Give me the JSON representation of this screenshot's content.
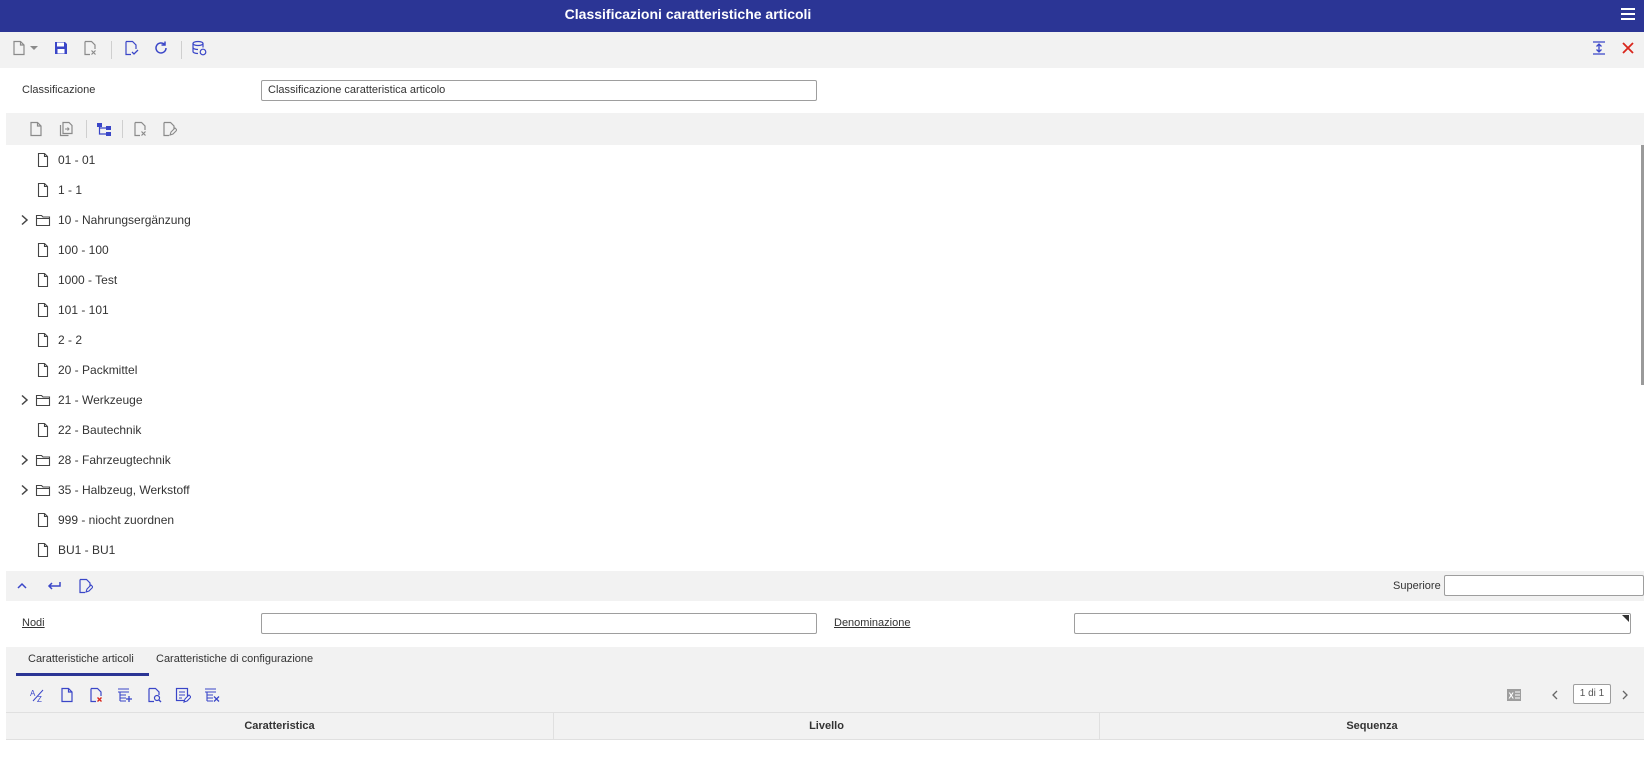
{
  "window": {
    "title": "Classificazioni caratteristiche articoli"
  },
  "colors": {
    "titlebar": "#2b3595",
    "accent": "#3a46c8",
    "close": "#d9261c",
    "icon_gray": "#8a8a8a"
  },
  "main_toolbar": {
    "icons": [
      "new-document-icon",
      "chevron-down-icon",
      "save-icon",
      "discard-icon",
      "validate-icon",
      "refresh-icon",
      "database-icon",
      "expand-vertical-icon",
      "close-icon"
    ]
  },
  "classification": {
    "label": "Classificazione",
    "value": "Classificazione caratteristica articolo"
  },
  "tree_toolbar": {
    "icons": [
      "new-node-icon",
      "duplicate-node-icon",
      "hierarchy-icon",
      "delete-node-icon",
      "edit-node-icon"
    ]
  },
  "tree": {
    "items": [
      {
        "label": "01 - 01",
        "type": "file",
        "expandable": false
      },
      {
        "label": "1 - 1",
        "type": "file",
        "expandable": false
      },
      {
        "label": "10 - Nahrungsergänzung",
        "type": "folder",
        "expandable": true
      },
      {
        "label": "100 - 100",
        "type": "file",
        "expandable": false
      },
      {
        "label": "1000 - Test",
        "type": "file",
        "expandable": false
      },
      {
        "label": "101 - 101",
        "type": "file",
        "expandable": false
      },
      {
        "label": "2 - 2",
        "type": "file",
        "expandable": false
      },
      {
        "label": "20 - Packmittel",
        "type": "file",
        "expandable": false
      },
      {
        "label": "21 - Werkzeuge",
        "type": "folder",
        "expandable": true
      },
      {
        "label": "22 - Bautechnik",
        "type": "file",
        "expandable": false
      },
      {
        "label": "28 - Fahrzeugtechnik",
        "type": "folder",
        "expandable": true
      },
      {
        "label": "35 - Halbzeug, Werkstoff",
        "type": "folder",
        "expandable": true
      },
      {
        "label": "999 - niocht zuordnen",
        "type": "file",
        "expandable": false
      },
      {
        "label": "BU1 - BU1",
        "type": "file",
        "expandable": false
      }
    ]
  },
  "nav_bar": {
    "icons": [
      "chevron-up-icon",
      "return-icon",
      "edit-document-icon"
    ],
    "parent_label": "Superiore",
    "parent_value": ""
  },
  "node_form": {
    "nodes_label": "Nodi",
    "nodes_value": "",
    "name_label": "Denominazione",
    "name_value": ""
  },
  "tabs": [
    {
      "label": "Caratteristiche articoli",
      "active": true
    },
    {
      "label": "Caratteristiche di configurazione",
      "active": false
    }
  ],
  "grid_toolbar": {
    "icons": [
      "sort-az-icon",
      "new-row-icon",
      "delete-row-icon",
      "insert-rows-icon",
      "search-document-icon",
      "edit-list-icon",
      "clear-list-icon",
      "excel-export-icon",
      "chevron-left-icon",
      "chevron-right-icon"
    ],
    "page_indicator": "1 di 1"
  },
  "grid": {
    "columns": [
      "Caratteristica",
      "Livello",
      "Sequenza"
    ],
    "rows": []
  }
}
